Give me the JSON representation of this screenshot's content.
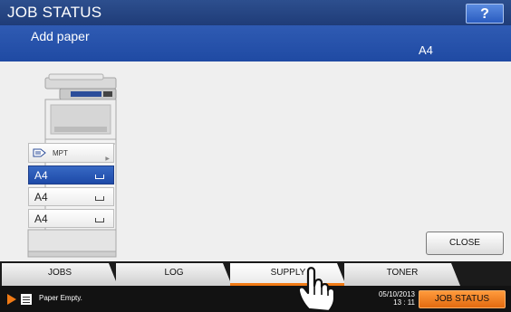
{
  "window": {
    "title": "JOB STATUS",
    "help_label": "?"
  },
  "message": {
    "text": "Add paper",
    "paper_size": "A4"
  },
  "device": {
    "mpt_label": "MPT",
    "trays": [
      {
        "label": "A4",
        "selected": true
      },
      {
        "label": "A4",
        "selected": false
      },
      {
        "label": "A4",
        "selected": false
      }
    ]
  },
  "close_label": "CLOSE",
  "tabs": [
    {
      "label": "JOBS",
      "active": false
    },
    {
      "label": "LOG",
      "active": false
    },
    {
      "label": "SUPPLY",
      "active": true
    },
    {
      "label": "TONER",
      "active": false
    }
  ],
  "status": {
    "message": "Paper Empty.",
    "date": "05/10/2013",
    "time": "13 : 11",
    "job_status_label": "JOB STATUS"
  },
  "colors": {
    "title_bar": "#1f3c78",
    "message_band": "#2f5bb3",
    "accent": "#f07a15",
    "selected_tray": "#1e4aa8"
  },
  "icons": [
    "help-icon",
    "tray-icon",
    "mpt-icon",
    "status-arrow-icon",
    "document-icon",
    "hand-cursor-icon"
  ]
}
